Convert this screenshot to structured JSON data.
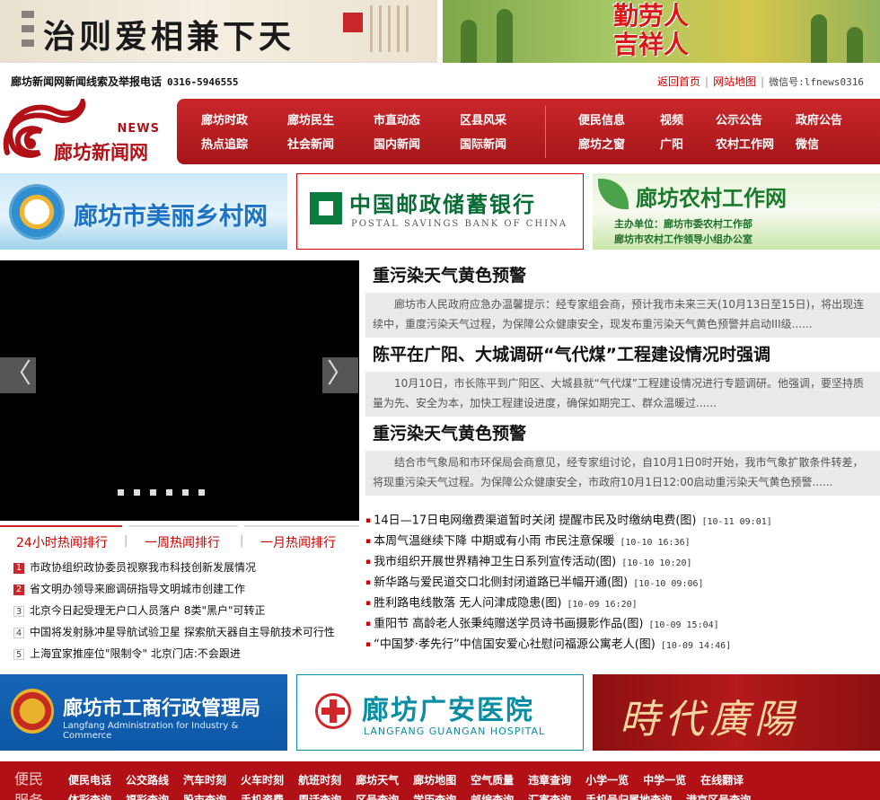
{
  "top_banner_left": {
    "calligraphy": "治则爱相兼下天"
  },
  "top_banner_right": {
    "line1": "勤劳人",
    "line2": "吉祥人"
  },
  "contact": {
    "label": "廊坊新闻网新闻线索及举报电话",
    "phone": "0316-5946555"
  },
  "top_links": {
    "home": "返回首页",
    "sitemap": "网站地图",
    "wechat": "微信号:lfnews0316"
  },
  "logo": {
    "news": "NEWS",
    "name": "廊坊新闻网"
  },
  "nav": {
    "left_row1": [
      "廊坊时政",
      "廊坊民生",
      "市直动态",
      "区县风采"
    ],
    "left_row2": [
      "热点追踪",
      "社会新闻",
      "国内新闻",
      "国际新闻"
    ],
    "right_row1": [
      "便民信息",
      "视频",
      "公示公告",
      "政府公告"
    ],
    "right_row2": [
      "廊坊之窗",
      "广阳",
      "农村工作网",
      "微信"
    ]
  },
  "ads": {
    "rural": "廊坊市美丽乡村网",
    "bank_cn": "中国邮政储蓄银行",
    "bank_en": "POSTAL SAVINGS BANK OF CHINA",
    "farm_title": "廊坊农村工作网",
    "farm_line1": "主办单位：廊坊市委农村工作部",
    "farm_line2": "廊坊市农村工作领导小组办公室"
  },
  "slider": {
    "prev": "〈",
    "next": "〉",
    "dot_count": 6
  },
  "headlines": [
    {
      "title": "重污染天气黄色预警",
      "summary": "廊坊市人民政府应急办温馨提示：经专家组会商，预计我市未来三天(10月13日至15日)，将出现连续中，重度污染天气过程，为保障公众健康安全，现发布重污染天气黄色预警并启动III级......"
    },
    {
      "title": "陈平在广阳、大城调研“气代煤”工程建设情况时强调",
      "summary": "10月10日，市长陈平到广阳区、大城县就“气代煤”工程建设情况进行专题调研。他强调，要坚持质量为先、安全为本，加快工程建设进度，确保如期完工、群众温暖过......"
    },
    {
      "title": "重污染天气黄色预警",
      "summary": "结合市气象局和市环保局会商意见，经专家组讨论，自10月1日0时开始，我市气象扩散条件转差，将现重污染天气过程。为保障公众健康安全，市政府10月1日12:00启动重污染天气黄色预警......"
    }
  ],
  "rank_tabs": [
    "24小时热闻排行",
    "一周热闻排行",
    "一月热闻排行"
  ],
  "rank_items": [
    {
      "num": "1",
      "text": "市政协组织政协委员视察我市科技创新发展情况"
    },
    {
      "num": "2",
      "text": "省文明办领导来廊调研指导文明城市创建工作"
    },
    {
      "num": "3",
      "text": "北京今日起受理无户口人员落户 8类\"黑户\"可转正"
    },
    {
      "num": "4",
      "text": "中国将发射脉冲星导航试验卫星 探索航天器自主导航技术可行性"
    },
    {
      "num": "5",
      "text": "上海宜家推座位\"限制令\" 北京门店:不会跟进"
    }
  ],
  "news_list": [
    {
      "text": "14日—17日电网缴费渠道暂时关闭 提醒市民及时缴纳电费(图)",
      "date": "[10-11 09:01]"
    },
    {
      "text": "本周气温继续下降 中期或有小雨 市民注意保暖",
      "date": "[10-10 16:36]"
    },
    {
      "text": "我市组织开展世界精神卫生日系列宣传活动(图)",
      "date": "[10-10 10:20]"
    },
    {
      "text": "新华路与爱民道交口北侧封闭道路已半幅开通(图)",
      "date": "[10-10 09:06]"
    },
    {
      "text": "胜利路电线散落 无人问津成隐患(图)",
      "date": "[10-09 16:20]"
    },
    {
      "text": "重阳节 高龄老人张秉纯赠送学员诗书画摄影作品(图)",
      "date": "[10-09 15:04]"
    },
    {
      "text": "“中国梦·孝先行”中信国安爱心社慰问福源公寓老人(图)",
      "date": "[10-09 14:46]"
    }
  ],
  "bottom_ads": {
    "aic": "廊坊市工商行政管理局",
    "aic_en": "Langfang Administration for Industry & Commerce",
    "hospital": "廊坊广安医院",
    "hospital_en": "LANGFANG GUANGAN HOSPITAL",
    "times": "時代廣陽"
  },
  "service": {
    "label": "便民服务",
    "row1": [
      "便民电话",
      "公交路线",
      "汽车时刻",
      "火车时刻",
      "航班时刻",
      "廊坊天气",
      "廊坊地图",
      "空气质量",
      "违章查询",
      "小学一览",
      "中学一览",
      "在线翻译"
    ],
    "row2": [
      "体彩查询",
      "福彩查询",
      "股市查询",
      "手机资费",
      "周话查询",
      "区号查询",
      "学历查询",
      "邮编查询",
      "汇率查询",
      "手机号归属地查询",
      "港京区号查询"
    ]
  },
  "colors": {
    "brand_red": "#b11116",
    "nav_red": "#c8272b"
  }
}
